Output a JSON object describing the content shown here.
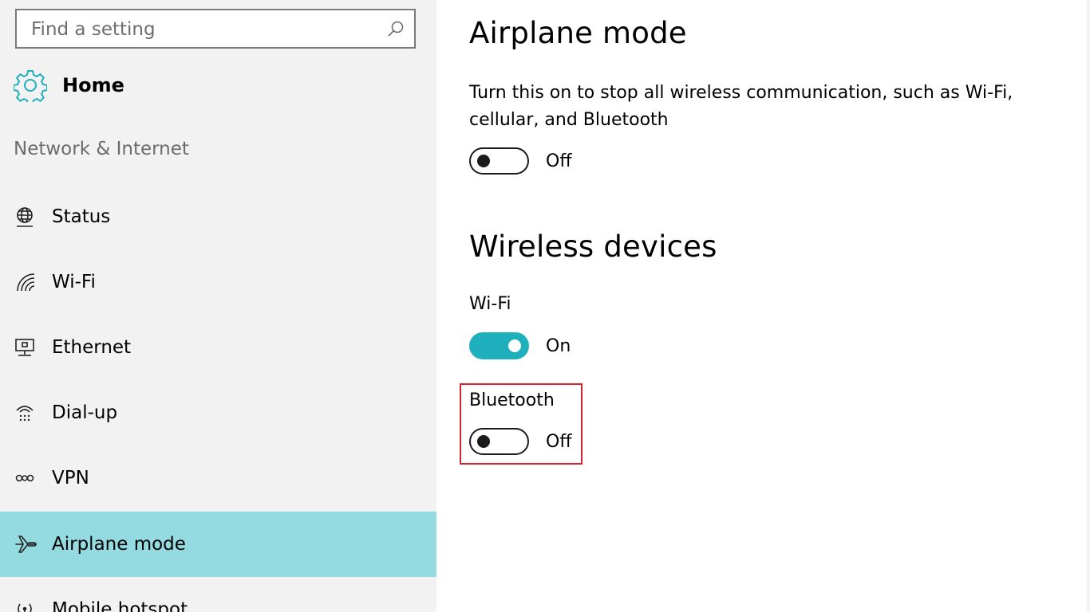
{
  "search": {
    "placeholder": "Find a setting"
  },
  "sidebar": {
    "home_label": "Home",
    "section_title": "Network & Internet",
    "items": [
      {
        "label": "Status",
        "icon": "globe-icon"
      },
      {
        "label": "Wi-Fi",
        "icon": "wifi-icon"
      },
      {
        "label": "Ethernet",
        "icon": "ethernet-icon"
      },
      {
        "label": "Dial-up",
        "icon": "dialup-icon"
      },
      {
        "label": "VPN",
        "icon": "vpn-icon"
      },
      {
        "label": "Airplane mode",
        "icon": "airplane-icon",
        "selected": true
      },
      {
        "label": "Mobile hotspot",
        "icon": "hotspot-icon"
      }
    ]
  },
  "main": {
    "airplane": {
      "title": "Airplane mode",
      "description": "Turn this on to stop all wireless communication, such as Wi-Fi, cellular, and Bluetooth",
      "state": "Off"
    },
    "wireless": {
      "title": "Wireless devices",
      "wifi_label": "Wi-Fi",
      "wifi_state": "On",
      "bluetooth_label": "Bluetooth",
      "bluetooth_state": "Off"
    }
  },
  "colors": {
    "accent": "#1fb0bd",
    "selected_bg": "#93dbe1",
    "highlight": "#d5232f"
  }
}
